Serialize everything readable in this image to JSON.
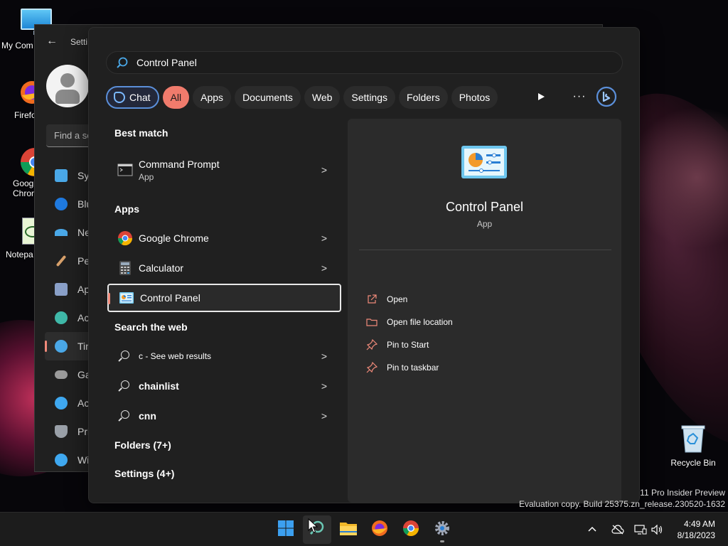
{
  "desktop": {
    "icons": [
      {
        "label": "My Com",
        "icon": "monitor-icon"
      },
      {
        "label": "Firefo",
        "icon": "firefox-icon"
      },
      {
        "label": "Goog Chron",
        "icon": "chrome-icon"
      },
      {
        "label": "Notepa",
        "icon": "notepad-icon"
      }
    ],
    "recycle_bin": "Recycle Bin",
    "watermark_line1": "11 Pro Insider Preview",
    "watermark_line2": "Evaluation copy. Build 25375.zn_release.230520-1632"
  },
  "settings_window": {
    "title": "Setti",
    "search_placeholder": "Find a se",
    "nav": [
      {
        "label": "Sys",
        "color": "#4aa8e8"
      },
      {
        "label": "Blu",
        "color": "#1f7ae0"
      },
      {
        "label": "Ne",
        "color": "#4aa8e8"
      },
      {
        "label": "Per",
        "color": "#d7a06a"
      },
      {
        "label": "Ap",
        "color": "#8aa0c8"
      },
      {
        "label": "Acc",
        "color": "#3fb8a8"
      },
      {
        "label": "Tin",
        "color": "#4aa8e8"
      },
      {
        "label": "Ga",
        "color": "#9a9a9a"
      },
      {
        "label": "Acc",
        "color": "#3fa8f0"
      },
      {
        "label": "Pri",
        "color": "#9aa0a8"
      },
      {
        "label": "Wi",
        "color": "#3fa8f0"
      }
    ]
  },
  "search": {
    "query": "Control Panel",
    "filters": [
      "Chat",
      "All",
      "Apps",
      "Documents",
      "Web",
      "Settings",
      "Folders",
      "Photos"
    ],
    "more": "···"
  },
  "results": {
    "best_match_header": "Best match",
    "best_match": {
      "title": "Command Prompt",
      "sub": "App"
    },
    "apps_header": "Apps",
    "apps": [
      {
        "title": "Google Chrome"
      },
      {
        "title": "Calculator"
      },
      {
        "title": "Control Panel"
      }
    ],
    "web_header": "Search the web",
    "web": [
      {
        "title": "c - See web results"
      },
      {
        "title": "chainlist"
      },
      {
        "title": "cnn"
      }
    ],
    "folders_header": "Folders (7+)",
    "settings_header": "Settings (4+)"
  },
  "preview": {
    "title": "Control Panel",
    "type": "App",
    "actions": [
      {
        "label": "Open",
        "icon": "open-external-icon"
      },
      {
        "label": "Open file location",
        "icon": "folder-icon"
      },
      {
        "label": "Pin to Start",
        "icon": "pin-icon"
      },
      {
        "label": "Pin to taskbar",
        "icon": "pin-icon"
      }
    ]
  },
  "taskbar": {
    "time": "4:49 AM",
    "date": "8/18/2023"
  },
  "colors": {
    "accent": "#f07b6c",
    "bing": "#5b8fd9"
  }
}
